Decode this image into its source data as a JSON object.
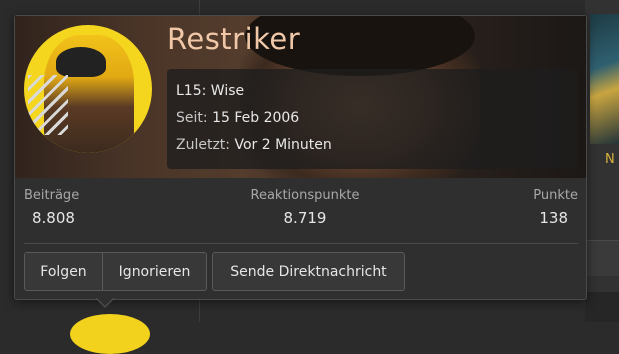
{
  "background": {
    "right_text": "N"
  },
  "profile": {
    "username": "Restriker",
    "title_label": "L15: Wise",
    "joined_label": "Seit:",
    "joined_value": "15 Feb 2006",
    "last_seen_label": "Zuletzt:",
    "last_seen_value": "Vor 2 Minuten"
  },
  "stats": {
    "posts_label": "Beiträge",
    "posts_value": "8.808",
    "reactions_label": "Reaktionspunkte",
    "reactions_value": "8.719",
    "points_label": "Punkte",
    "points_value": "138"
  },
  "actions": {
    "follow": "Folgen",
    "ignore": "Ignorieren",
    "message": "Sende Direktnachricht"
  },
  "colors": {
    "username": "#f0c8a8",
    "avatar_bg": "#f4d61f",
    "card_bg": "#2f2f2f"
  }
}
